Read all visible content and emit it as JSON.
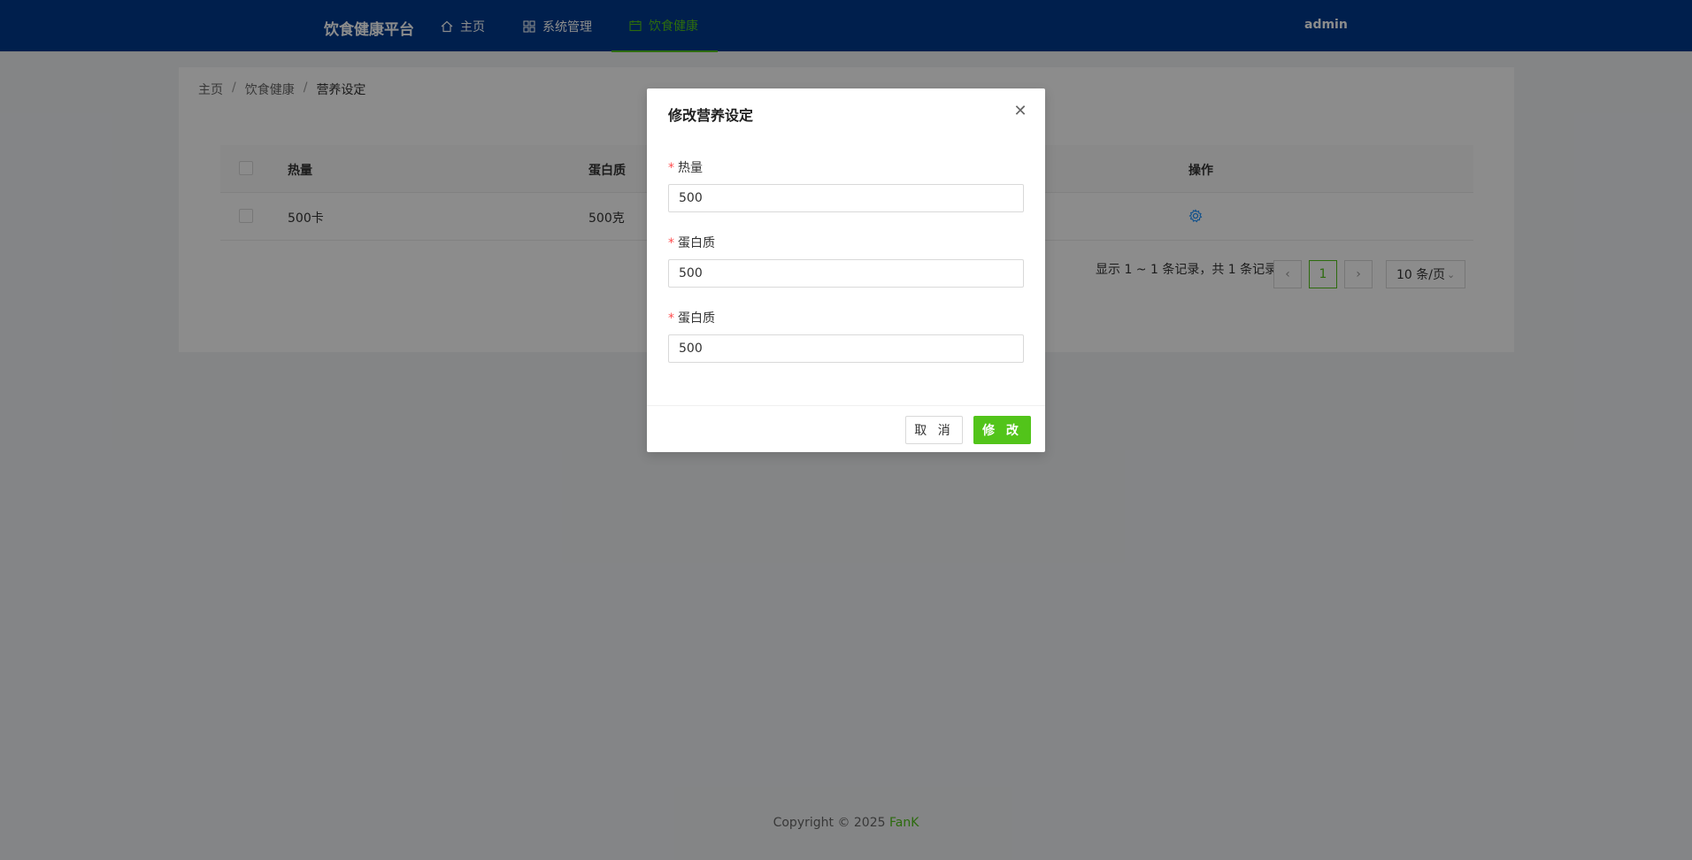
{
  "header": {
    "brand": "饮食健康平台",
    "nav": [
      {
        "label": "主页",
        "icon": "home-icon"
      },
      {
        "label": "系统管理",
        "icon": "grid-icon"
      },
      {
        "label": "饮食健康",
        "icon": "calendar-icon"
      }
    ],
    "user": "admin"
  },
  "breadcrumb": {
    "items": [
      "主页",
      "饮食健康",
      "营养设定"
    ],
    "separator": "/"
  },
  "table": {
    "columns": [
      "热量",
      "蛋白质",
      "操作"
    ],
    "rows": [
      {
        "calories": "500卡",
        "protein": "500克"
      }
    ]
  },
  "pagination": {
    "summary": "显示 1 ~ 1 条记录，共 1 条记录",
    "current_page": "1",
    "page_size": "10 条/页"
  },
  "footer": {
    "copyright": "Copyright © 2025 ",
    "author": "FanK"
  },
  "modal": {
    "title": "修改营养设定",
    "fields": [
      {
        "label": "热量",
        "value": "500"
      },
      {
        "label": "蛋白质",
        "value": "500"
      },
      {
        "label": "蛋白质",
        "value": "500"
      }
    ],
    "required_mark": "*",
    "cancel_label": "取 消",
    "ok_label": "修 改"
  },
  "colors": {
    "header_bg": "#003a8c",
    "accent": "#52c41a",
    "overlay": "rgba(0,0,0,0.45)"
  }
}
